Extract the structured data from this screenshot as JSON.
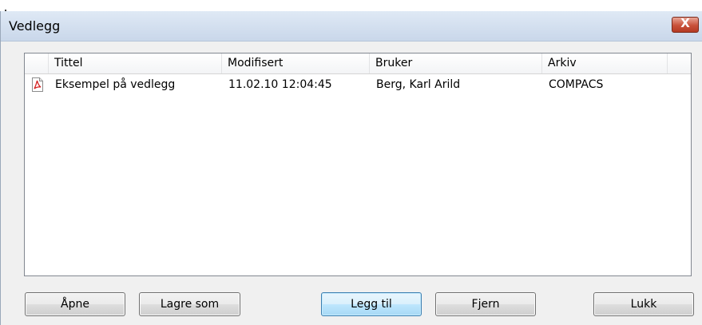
{
  "window": {
    "title": "Vedlegg"
  },
  "titlebar": {
    "close_glyph": "X"
  },
  "list": {
    "columns": [
      "Tittel",
      "Modifisert",
      "Bruker",
      "Arkiv"
    ],
    "rows": [
      {
        "icon": "pdf-file-icon",
        "title": "Eksempel på vedlegg",
        "modified": "11.02.10 12:04:45",
        "user": "Berg, Karl Arild",
        "archive": "COMPACS"
      }
    ]
  },
  "buttons": {
    "open": "Åpne",
    "save_as": "Lagre som",
    "add": "Legg til",
    "remove": "Fjern",
    "close": "Lukk"
  },
  "colors": {
    "titlebar": "#dfe9f5",
    "close_button": "#c8513a",
    "default_button": "#bee6fd",
    "pdf_icon": "#d31f1f"
  }
}
